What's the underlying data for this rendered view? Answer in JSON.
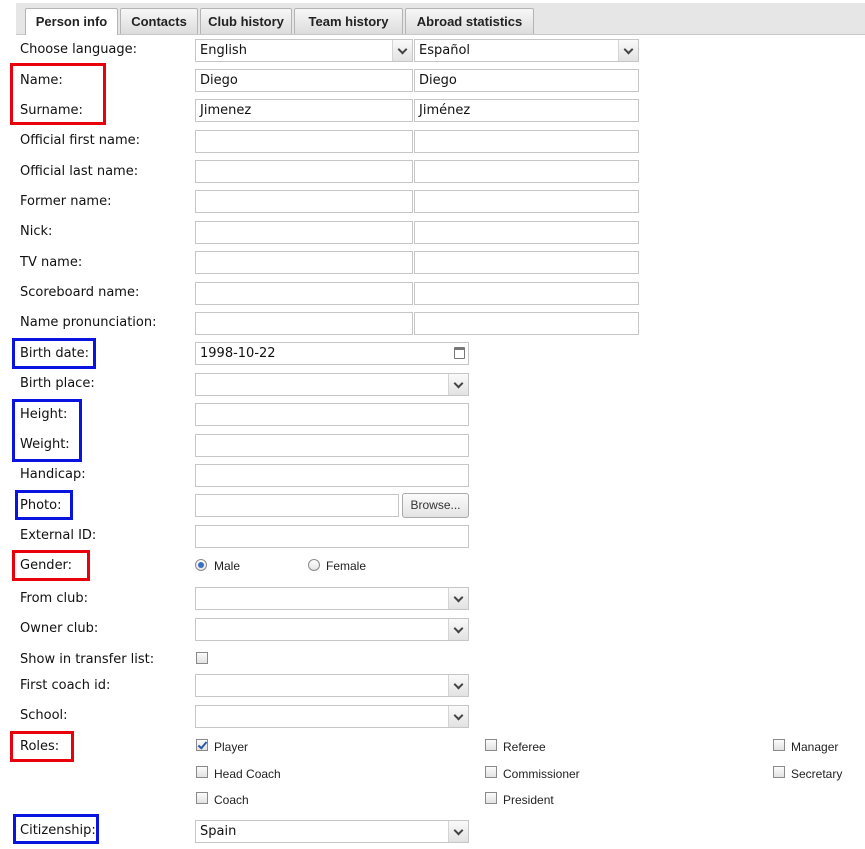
{
  "tabs": [
    "Person info",
    "Contacts",
    "Club history",
    "Team history",
    "Abroad statistics"
  ],
  "language": {
    "label": "Choose language:",
    "primary": "English",
    "secondary": "Español"
  },
  "name": {
    "label": "Name:",
    "primary": "Diego",
    "secondary": "Diego"
  },
  "surname": {
    "label": "Surname:",
    "primary": "Jimenez",
    "secondary": "Jiménez"
  },
  "official_first_name": {
    "label": "Official first name:"
  },
  "official_last_name": {
    "label": "Official last name:"
  },
  "former_name": {
    "label": "Former name:"
  },
  "nick": {
    "label": "Nick:"
  },
  "tv_name": {
    "label": "TV name:"
  },
  "scoreboard_name": {
    "label": "Scoreboard name:"
  },
  "name_pronunciation": {
    "label": "Name pronunciation:"
  },
  "birth_date": {
    "label": "Birth date:",
    "value": "1998-10-22"
  },
  "birth_place": {
    "label": "Birth place:",
    "value": ""
  },
  "height": {
    "label": "Height:",
    "value": ""
  },
  "weight": {
    "label": "Weight:",
    "value": ""
  },
  "handicap": {
    "label": "Handicap:",
    "value": ""
  },
  "photo": {
    "label": "Photo:",
    "value": "",
    "browse_label": "Browse..."
  },
  "external_id": {
    "label": "External ID:",
    "value": ""
  },
  "gender": {
    "label": "Gender:",
    "options": [
      "Male",
      "Female"
    ],
    "selected": "Male"
  },
  "from_club": {
    "label": "From club:",
    "value": ""
  },
  "owner_club": {
    "label": "Owner club:",
    "value": ""
  },
  "show_in_transfer_list": {
    "label": "Show in transfer list:",
    "checked": false
  },
  "first_coach_id": {
    "label": "First coach id:",
    "value": ""
  },
  "school": {
    "label": "School:",
    "value": ""
  },
  "roles": {
    "label": "Roles:",
    "items": [
      {
        "label": "Player",
        "checked": true
      },
      {
        "label": "Referee",
        "checked": false
      },
      {
        "label": "Manager",
        "checked": false
      },
      {
        "label": "Head Coach",
        "checked": false
      },
      {
        "label": "Commissioner",
        "checked": false
      },
      {
        "label": "Secretary",
        "checked": false
      },
      {
        "label": "Coach",
        "checked": false
      },
      {
        "label": "President",
        "checked": false
      }
    ]
  },
  "citizenship": {
    "label": "Citizenship:",
    "value": "Spain"
  },
  "colors": {
    "red_highlight": "#e8000b",
    "blue_highlight": "#0a14e0",
    "radio_accent": "#3a6fc4"
  }
}
